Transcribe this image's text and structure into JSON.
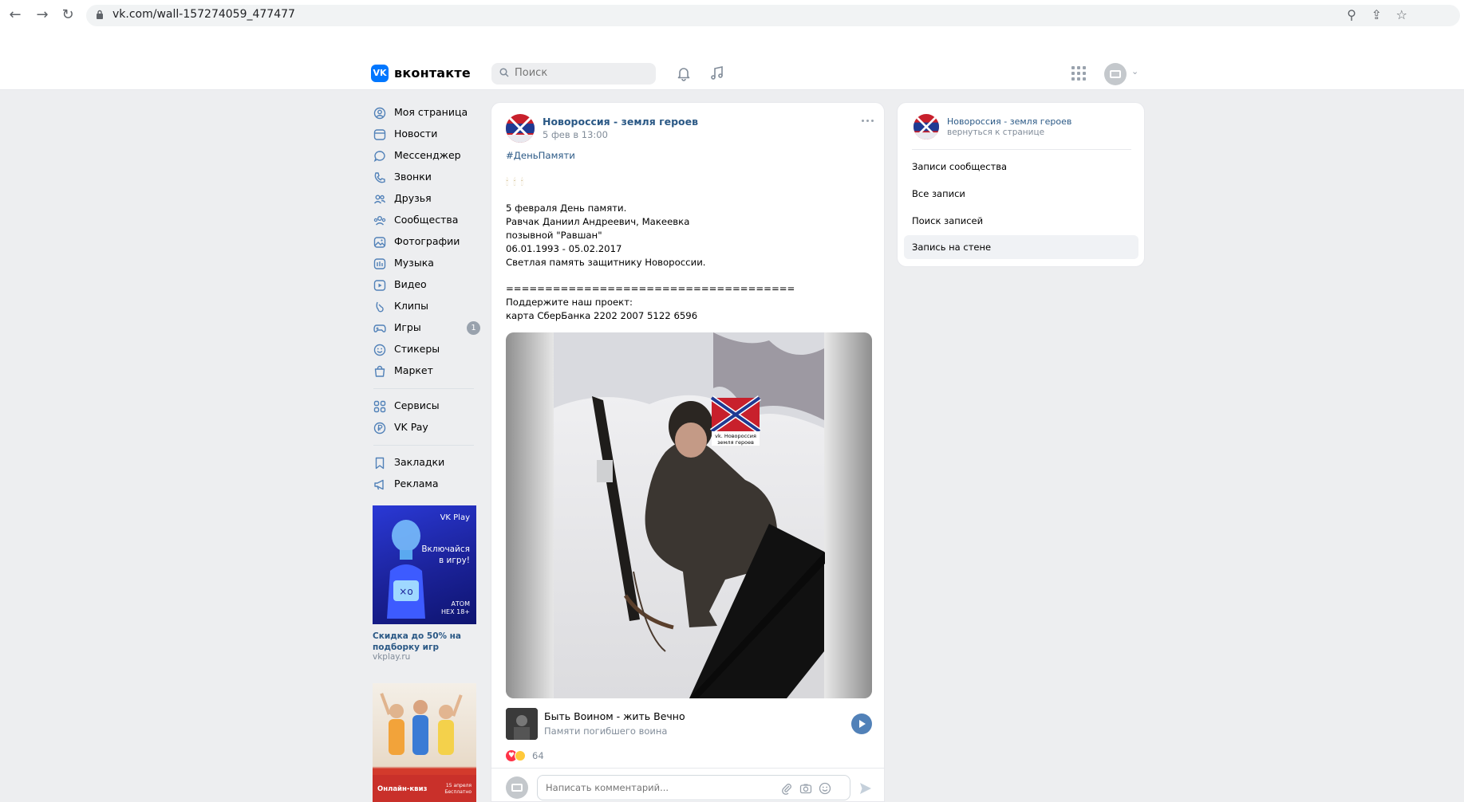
{
  "browser": {
    "url": "vk.com/wall-157274059_477477"
  },
  "header": {
    "logo_mark": "VK",
    "brand": "вконтакте",
    "search_placeholder": "Поиск"
  },
  "menu": {
    "items": [
      {
        "label": "Моя страница",
        "icon": "user-circle-icon"
      },
      {
        "label": "Новости",
        "icon": "newspaper-icon"
      },
      {
        "label": "Мессенджер",
        "icon": "message-icon"
      },
      {
        "label": "Звонки",
        "icon": "phone-icon"
      },
      {
        "label": "Друзья",
        "icon": "friends-icon"
      },
      {
        "label": "Сообщества",
        "icon": "communities-icon"
      },
      {
        "label": "Фотографии",
        "icon": "photo-icon"
      },
      {
        "label": "Музыка",
        "icon": "music-icon"
      },
      {
        "label": "Видео",
        "icon": "video-icon"
      },
      {
        "label": "Клипы",
        "icon": "clips-icon"
      },
      {
        "label": "Игры",
        "icon": "gamepad-icon",
        "badge": "1"
      },
      {
        "label": "Стикеры",
        "icon": "smile-icon"
      },
      {
        "label": "Маркет",
        "icon": "bag-icon"
      }
    ],
    "items2": [
      {
        "label": "Сервисы",
        "icon": "grid-icon"
      },
      {
        "label": "VK Pay",
        "icon": "pay-icon"
      }
    ],
    "items3": [
      {
        "label": "Закладки",
        "icon": "bookmark-icon"
      },
      {
        "label": "Реклама",
        "icon": "megaphone-icon"
      }
    ]
  },
  "ads": {
    "ad1_brand": "VK Play",
    "ad1_line1": "Включайся",
    "ad1_line2": "в игру!",
    "ad1_corner1": "АТОМ",
    "ad1_corner2": "НЕХ 18+",
    "ad1_title": "Скидка до 50% на подборку игр",
    "ad1_domain": "vkplay.ru",
    "ad2_band": "Онлайн-квиз",
    "ad2_date1": "15 апреля",
    "ad2_date2": "Бесплатно"
  },
  "post": {
    "author": "Новороссия - земля героев",
    "date": "5 фев в 13:00",
    "hashtag": "#ДеньПамяти",
    "candles": "🕯🕯🕯",
    "lines": [
      "5 февраля День памяти.",
      "Равчак Даниил Андреевич, Макеевка",
      "позывной \"Равшан\"",
      "06.01.1993 - 05.02.2017",
      "Светлая память защитнику Новороссии."
    ],
    "separator": "=====================================",
    "support": [
      "Поддержите наш проект:",
      "карта СберБанка 2202 2007 5122 6596"
    ],
    "watermark1": "vk. Новороссия",
    "watermark2": "земля героев",
    "audio_title": "Быть Воином - жить Вечно",
    "audio_subtitle": "Памяти погибшего воина",
    "reactions_count": "64",
    "comment_placeholder": "Написать комментарий..."
  },
  "right": {
    "community": "Новороссия - земля героев",
    "back": "вернуться к странице",
    "items": [
      "Записи сообщества",
      "Все записи",
      "Поиск записей",
      "Запись на стене"
    ]
  },
  "colors": {
    "vk_blue": "#0077ff",
    "link": "#2a5885",
    "secondary_text": "#818c99",
    "background": "#edeef0",
    "play_button": "#5181b8",
    "like_red": "#ff3347"
  }
}
